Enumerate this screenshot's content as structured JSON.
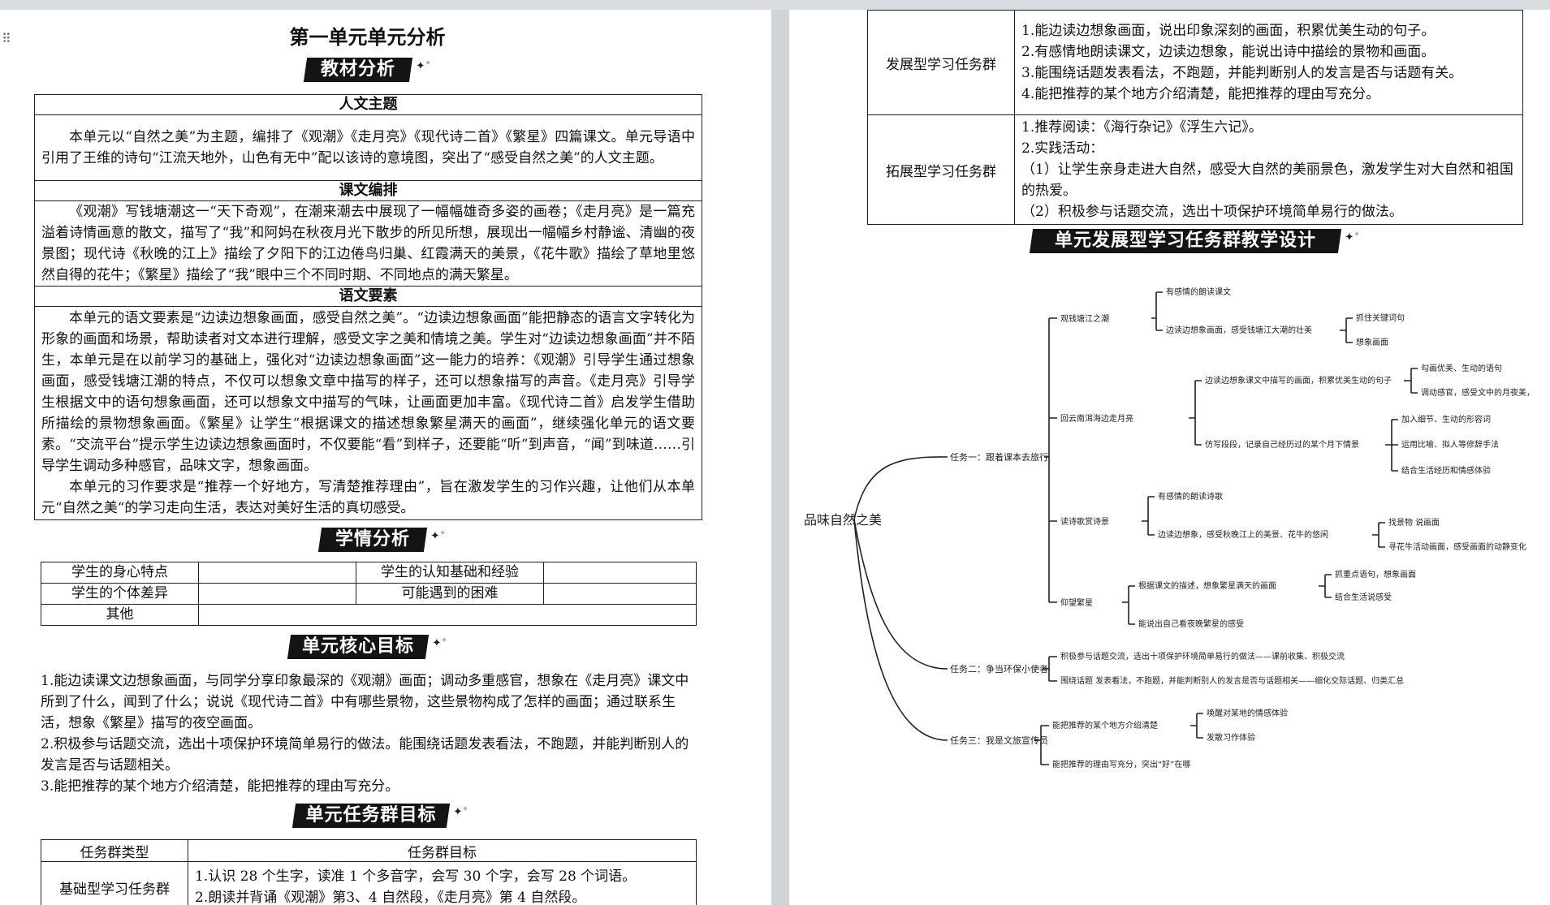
{
  "left_page": {
    "title": "第一单元单元分析",
    "banner_textbook": "教材分析",
    "section_theme": "人文主题",
    "theme_text": "本单元以“自然之美”为主题，编排了《观潮》《走月亮》《现代诗二首》《繁星》四篇课文。单元导语中引用了王维的诗句“江流天地外，山色有无中”配以该诗的意境图，突出了“感受自然之美”的人文主题。",
    "section_arrangement": "课文编排",
    "arrangement_text": "《观潮》写钱塘潮这一“天下奇观”，在潮来潮去中展现了一幅幅雄奇多姿的画卷；《走月亮》是一篇充溢着诗情画意的散文，描写了“我”和阿妈在秋夜月光下散步的所见所想，展现出一幅幅乡村静谧、清幽的夜景图；现代诗《秋晚的江上》描绘了夕阳下的江边倦鸟归巢、红霞满天的美景，《花牛歌》描绘了草地里悠然自得的花牛；《繁星》描绘了“我”眼中三个不同时期、不同地点的满天繁星。",
    "section_elements": "语文要素",
    "elements_text_1": "本单元的语文要素是“边读边想象画面，感受自然之美”。“边读边想象画面”能把静态的语言文字转化为形象的画面和场景，帮助读者对文本进行理解，感受文字之美和情境之美。学生对“边读边想象画面”并不陌生，本单元是在以前学习的基础上，强化对“边读边想象画面”这一能力的培养：《观潮》引导学生通过想象画面，感受钱塘江潮的特点，不仅可以想象文章中描写的样子，还可以想象描写的声音。《走月亮》引导学生根据文中的语句想象画面，还可以想象文中描写的气味，让画面更加丰富。《现代诗二首》启发学生借助所描绘的景物想象画面。《繁星》让学生“根据课文的描述想象繁星满天的画面”，继续强化单元的语文要素。“交流平台”提示学生边读边想象画面时，不仅要能“看”到样子，还要能“听”到声音，“闻”到味道……引导学生调动多种感官，品味文字，想象画面。",
    "elements_text_2": "本单元的习作要求是“推荐一个好地方，写清楚推荐理由”，旨在激发学生的习作兴趣，让他们从本单元“自然之美“的学习走向生活，表达对美好生活的真切感受。",
    "banner_students": "学情分析",
    "students": {
      "r1c1": "学生的身心特点",
      "r1c3": "学生的认知基础和经验",
      "r2c1": "学生的个体差异",
      "r2c3": "可能遇到的困难",
      "r3c1": "其他"
    },
    "banner_core": "单元核心目标",
    "core_goals": [
      "1.能边读课文边想象画面，与同学分享印象最深的《观潮》画面；调动多重感官，想象在《走月亮》课文中所到了什么，闻到了什么；说说《现代诗二首》中有哪些景物，这些景物构成了怎样的画面；通过联系生活，想象《繁星》描写的夜空画面。",
      "2.积极参与话题交流，选出十项保护环境简单易行的做法。能围绕话题发表看法，不跑题，并能判断别人的发言是否与话题相关。",
      "3.能把推荐的某个地方介绍清楚，能把推荐的理由写充分。"
    ],
    "banner_tasks": "单元任务群目标",
    "task_table": {
      "head_type": "任务群类型",
      "head_goal": "任务群目标",
      "basic_type": "基础型学习任务群",
      "basic_goals": [
        "1.认识 28 个生字，读准 1 个多音字，会写 30 个字，会写 28 个词语。",
        "2.朗读并背诵《观潮》第3、4 自然段，《走月亮》第 4 自然段。"
      ]
    }
  },
  "right_page": {
    "dev_type": "发展型学习任务群",
    "dev_goals": [
      "1.能边读边想象画面，说出印象深刻的画面，积累优美生动的句子。",
      "2.有感情地朗读课文，边读边想象，能说出诗中描绘的景物和画面。",
      "3.能围绕话题发表看法，不跑题，并能判断别人的发言是否与话题有关。",
      "4.能把推荐的某个地方介绍清楚，能把推荐的理由写充分。"
    ],
    "ext_type": "拓展型学习任务群",
    "ext_goals": [
      "1.推荐阅读：《海行杂记》《浮生六记》。",
      "2.实践活动：",
      "（1）让学生亲身走进大自然，感受大自然的美丽景色，激发学生对大自然和祖国的热爱。",
      "（2）积极参与话题交流，选出十项保护环境简单易行的做法。"
    ],
    "banner_design": "单元发展型学习任务群教学设计",
    "mindmap": {
      "root": "品味自然之美",
      "task1": "任务一：跟着课本去旅行",
      "t1_guanchao": "观钱塘江之潮",
      "t1_gc_a": "有感情的朗读课文",
      "t1_gc_b": "边读边想象画面，感受钱塘江大潮的壮美",
      "t1_gc_b1": "抓住关键词句",
      "t1_gc_b2": "想象画面",
      "t1_yue": "回云南洱海边走月亮",
      "t1_yue_a": "边读边想象课文中描写的画面，积累优美生动的句子",
      "t1_yue_a1": "勾画优美、生动的语句",
      "t1_yue_a2": "调动感官，感受文中的月夜美，",
      "t1_yue_b": "仿写段段，记录自己经历过的某个月下情景",
      "t1_yue_b1": "加入细节、生动的形容词",
      "t1_yue_b2": "运用比喻、拟人等修辞手法",
      "t1_yue_b3": "结合生活经历和情感体验",
      "t1_shi": "读诗歌赏诗景",
      "t1_shi_a": "有感情的朗读诗歌",
      "t1_shi_b": "边读边想象，感受秋晚江上的美景、花牛的悠闲",
      "t1_shi_b1": "找景物 说画面",
      "t1_shi_b2": "寻花牛活动画面，感受画面的动静变化",
      "t1_xing": "仰望繁星",
      "t1_xing_a": "根据课文的描述，想象繁星满天的画面",
      "t1_xing_a1": "抓重点语句，想象画面",
      "t1_xing_a2": "结合生活说感受",
      "t1_xing_b": "能说出自己看夜晚繁星的感受",
      "task2": "任务二：争当环保小使者",
      "t2_a": "积极参与话题交流，选出十项保护环境简单易行的做法——课前收集、积极交流",
      "t2_b": "围绕话题 发表看法，不跑题，并能判断别人的发言是否与话题相关——细化交际话题、归类汇总",
      "task3": "任务三：我是文旅宣传员",
      "t3_a": "能把推荐的某个地方介绍清楚",
      "t3_a1": "唤醒对某地的情感体验",
      "t3_a2": "发散习作体验",
      "t3_b": "能把推荐的理由写充分，突出“好”在哪"
    }
  }
}
